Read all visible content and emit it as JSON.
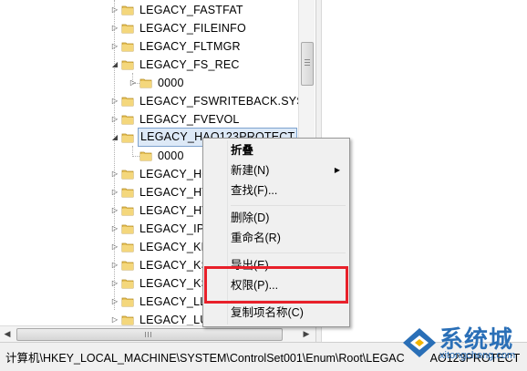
{
  "tree": {
    "nodes": [
      {
        "label": "LEGACY_FASTFAT"
      },
      {
        "label": "LEGACY_FILEINFO"
      },
      {
        "label": "LEGACY_FLTMGR"
      },
      {
        "label": "LEGACY_FS_REC"
      },
      {
        "label": "0000"
      },
      {
        "label": "LEGACY_FSWRITEBACK.SYS"
      },
      {
        "label": "LEGACY_FVEVOL"
      },
      {
        "label": "LEGACY_HAO123PROTECT"
      },
      {
        "label": "0000"
      },
      {
        "label": "LEGACY_HC"
      },
      {
        "label": "LEGACY_HT"
      },
      {
        "label": "LEGACY_HV"
      },
      {
        "label": "LEGACY_IP"
      },
      {
        "label": "LEGACY_KE"
      },
      {
        "label": "LEGACY_KS"
      },
      {
        "label": "LEGACY_KS"
      },
      {
        "label": "LEGACY_LL"
      },
      {
        "label": "LEGACY_LU"
      }
    ]
  },
  "context_menu": {
    "items": {
      "collapse": "折叠",
      "new": "新建(N)",
      "find": "查找(F)...",
      "delete": "删除(D)",
      "rename": "重命名(R)",
      "export": "导出(E)",
      "permissions": "权限(P)...",
      "copy_key_name": "复制项名称(C)"
    }
  },
  "statusbar": {
    "path": "计算机\\HKEY_LOCAL_MACHINE\\SYSTEM\\ControlSet001\\Enum\\Root\\LEGAC",
    "path_tail": "AO123PROTECT"
  },
  "watermark": {
    "text": "系统城",
    "domain": "xitongcheng.com"
  },
  "colors": {
    "highlight_red": "#e8202a",
    "selection_bg": "#dde9f7",
    "folder_yellow": "#e8c35a"
  }
}
